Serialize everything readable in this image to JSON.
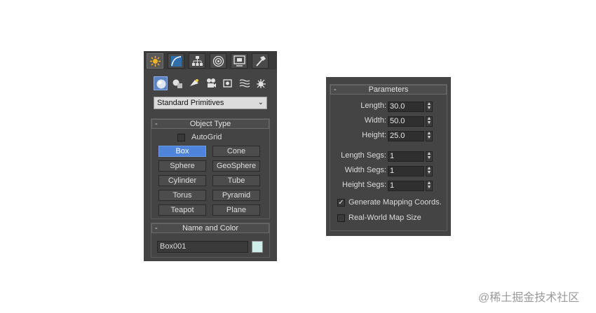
{
  "create_panel": {
    "tabs": [
      {
        "icon": "create-star-icon"
      },
      {
        "icon": "modify-curve-icon"
      },
      {
        "icon": "hierarchy-icon"
      },
      {
        "icon": "motion-icon"
      },
      {
        "icon": "display-icon"
      },
      {
        "icon": "utilities-hammer-icon"
      }
    ],
    "categories": [
      {
        "icon": "geometry-sphere-icon"
      },
      {
        "icon": "shapes-icon"
      },
      {
        "icon": "lights-icon"
      },
      {
        "icon": "cameras-icon"
      },
      {
        "icon": "helpers-icon"
      },
      {
        "icon": "spacewarps-icon"
      },
      {
        "icon": "systems-icon"
      }
    ],
    "dropdown_value": "Standard Primitives",
    "object_type": {
      "title": "Object Type",
      "collapse": "-",
      "autogrid_label": "AutoGrid",
      "buttons": [
        "Box",
        "Cone",
        "Sphere",
        "GeoSphere",
        "Cylinder",
        "Tube",
        "Torus",
        "Pyramid",
        "Teapot",
        "Plane"
      ]
    },
    "name_color": {
      "title": "Name and Color",
      "collapse": "-",
      "name_value": "Box001",
      "swatch_color": "#cfeeea"
    }
  },
  "parameters": {
    "title": "Parameters",
    "collapse": "-",
    "fields": [
      {
        "label": "Length:",
        "value": "30.0"
      },
      {
        "label": "Width:",
        "value": "50.0"
      },
      {
        "label": "Height:",
        "value": "25.0"
      },
      {
        "label": "Length Segs:",
        "value": "1"
      },
      {
        "label": "Width Segs:",
        "value": "1"
      },
      {
        "label": "Height Segs:",
        "value": "1"
      }
    ],
    "generate_mapping_label": "Generate Mapping Coords.",
    "generate_mapping_checked": true,
    "real_world_label": "Real-World Map Size",
    "real_world_checked": false
  },
  "watermark": "@稀土掘金技术社区",
  "colors": {
    "panel_bg": "#444444",
    "active_button": "#4e84dc"
  }
}
